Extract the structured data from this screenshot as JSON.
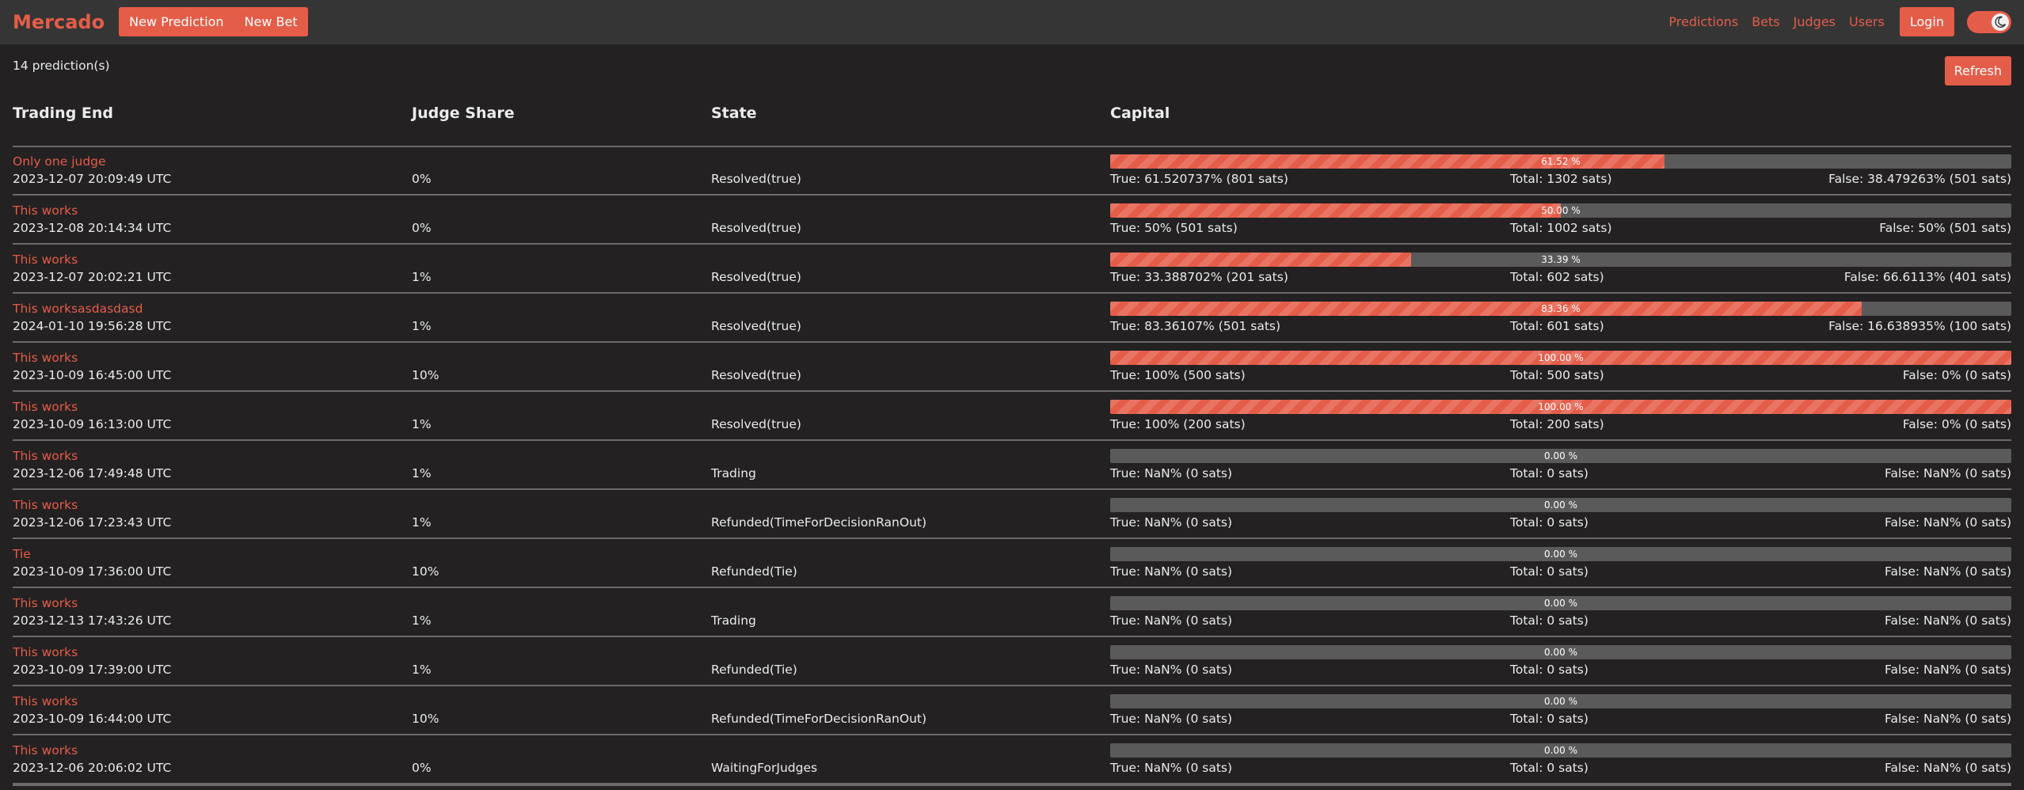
{
  "navbar": {
    "brand": "Mercado",
    "new_prediction": "New Prediction",
    "new_bet": "New Bet",
    "links": [
      "Predictions",
      "Bets",
      "Judges",
      "Users"
    ],
    "login": "Login",
    "theme_toggle_icon": "moon-icon"
  },
  "colors": {
    "accent": "#e45d49",
    "background": "#232122",
    "navbar": "#363535",
    "bar_empty": "#5a5a5a"
  },
  "summary": {
    "count_text": "14 prediction(s)",
    "refresh": "Refresh"
  },
  "table": {
    "headers": [
      "Trading End",
      "Judge Share",
      "State",
      "Capital"
    ],
    "rows": [
      {
        "title": "Only one judge",
        "date": "2023-12-07 20:09:49 UTC",
        "judge": "0%",
        "state": "Resolved(true)",
        "pct": 61.52,
        "pct_label": "61.52 %",
        "true_text": "True: 61.520737% (801 sats)",
        "total_text": "Total: 1302 sats)",
        "false_text": "False: 38.479263% (501 sats)"
      },
      {
        "title": "This works",
        "date": "2023-12-08 20:14:34 UTC",
        "judge": "0%",
        "state": "Resolved(true)",
        "pct": 50.0,
        "pct_label": "50.00 %",
        "true_text": "True: 50% (501 sats)",
        "total_text": "Total: 1002 sats)",
        "false_text": "False: 50% (501 sats)"
      },
      {
        "title": "This works",
        "date": "2023-12-07 20:02:21 UTC",
        "judge": "1%",
        "state": "Resolved(true)",
        "pct": 33.39,
        "pct_label": "33.39 %",
        "true_text": "True: 33.388702% (201 sats)",
        "total_text": "Total: 602 sats)",
        "false_text": "False: 66.6113% (401 sats)"
      },
      {
        "title": "This worksasdasdasd",
        "date": "2024-01-10 19:56:28 UTC",
        "judge": "1%",
        "state": "Resolved(true)",
        "pct": 83.36,
        "pct_label": "83.36 %",
        "true_text": "True: 83.36107% (501 sats)",
        "total_text": "Total: 601 sats)",
        "false_text": "False: 16.638935% (100 sats)"
      },
      {
        "title": "This works",
        "date": "2023-10-09 16:45:00 UTC",
        "judge": "10%",
        "state": "Resolved(true)",
        "pct": 100,
        "pct_label": "100.00 %",
        "true_text": "True: 100% (500 sats)",
        "total_text": "Total: 500 sats)",
        "false_text": "False: 0% (0 sats)"
      },
      {
        "title": "This works",
        "date": "2023-10-09 16:13:00 UTC",
        "judge": "1%",
        "state": "Resolved(true)",
        "pct": 100,
        "pct_label": "100.00 %",
        "true_text": "True: 100% (200 sats)",
        "total_text": "Total: 200 sats)",
        "false_text": "False: 0% (0 sats)"
      },
      {
        "title": "This works",
        "date": "2023-12-06 17:49:48 UTC",
        "judge": "1%",
        "state": "Trading",
        "pct": 0,
        "pct_label": "0.00 %",
        "true_text": "True: NaN% (0 sats)",
        "total_text": "Total: 0 sats)",
        "false_text": "False: NaN% (0 sats)"
      },
      {
        "title": "This works",
        "date": "2023-12-06 17:23:43 UTC",
        "judge": "1%",
        "state": "Refunded(TimeForDecisionRanOut)",
        "pct": 0,
        "pct_label": "0.00 %",
        "true_text": "True: NaN% (0 sats)",
        "total_text": "Total: 0 sats)",
        "false_text": "False: NaN% (0 sats)"
      },
      {
        "title": "Tie",
        "date": "2023-10-09 17:36:00 UTC",
        "judge": "10%",
        "state": "Refunded(Tie)",
        "pct": 0,
        "pct_label": "0.00 %",
        "true_text": "True: NaN% (0 sats)",
        "total_text": "Total: 0 sats)",
        "false_text": "False: NaN% (0 sats)"
      },
      {
        "title": "This works",
        "date": "2023-12-13 17:43:26 UTC",
        "judge": "1%",
        "state": "Trading",
        "pct": 0,
        "pct_label": "0.00 %",
        "true_text": "True: NaN% (0 sats)",
        "total_text": "Total: 0 sats)",
        "false_text": "False: NaN% (0 sats)"
      },
      {
        "title": "This works",
        "date": "2023-10-09 17:39:00 UTC",
        "judge": "1%",
        "state": "Refunded(Tie)",
        "pct": 0,
        "pct_label": "0.00 %",
        "true_text": "True: NaN% (0 sats)",
        "total_text": "Total: 0 sats)",
        "false_text": "False: NaN% (0 sats)"
      },
      {
        "title": "This works",
        "date": "2023-10-09 16:44:00 UTC",
        "judge": "10%",
        "state": "Refunded(TimeForDecisionRanOut)",
        "pct": 0,
        "pct_label": "0.00 %",
        "true_text": "True: NaN% (0 sats)",
        "total_text": "Total: 0 sats)",
        "false_text": "False: NaN% (0 sats)"
      },
      {
        "title": "This works",
        "date": "2023-12-06 20:06:02 UTC",
        "judge": "0%",
        "state": "WaitingForJudges",
        "pct": 0,
        "pct_label": "0.00 %",
        "true_text": "True: NaN% (0 sats)",
        "total_text": "Total: 0 sats)",
        "false_text": "False: NaN% (0 sats)"
      }
    ]
  }
}
